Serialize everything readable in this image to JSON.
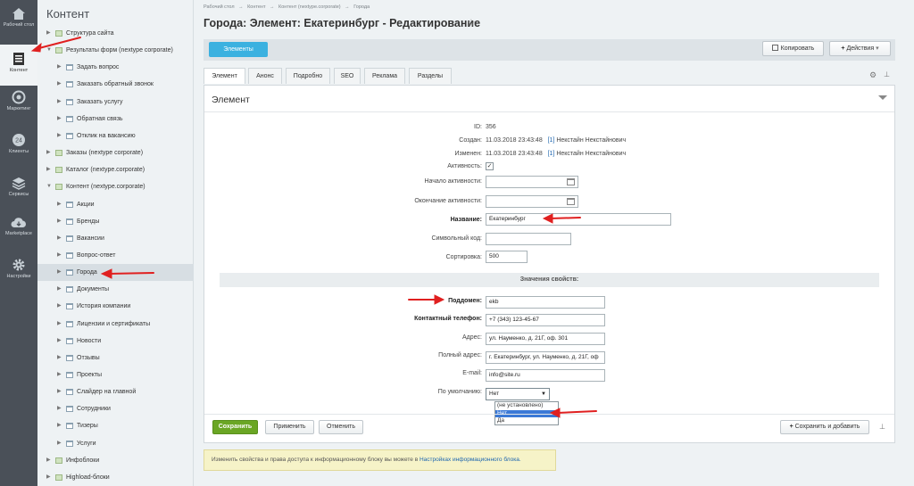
{
  "left_menu": [
    {
      "label": "Рабочий стол",
      "icon": "home-icon"
    },
    {
      "label": "Контент",
      "icon": "document-icon",
      "active": true
    },
    {
      "label": "Маркетинг",
      "icon": "target-icon"
    },
    {
      "label": "Клиенты",
      "icon": "clients-24-icon"
    },
    {
      "label": "Сервисы",
      "icon": "layers-icon"
    },
    {
      "label": "Marketplace",
      "icon": "cloud-download-icon"
    },
    {
      "label": "Настройки",
      "icon": "gear-icon"
    }
  ],
  "tree": {
    "title": "Контент",
    "items": [
      {
        "label": "Структура сайта",
        "level": 0,
        "type": "folder"
      },
      {
        "label": "Результаты форм (nextype corporate)",
        "level": 0,
        "type": "folder",
        "open": true
      },
      {
        "label": "Задать вопрос",
        "level": 1,
        "type": "page"
      },
      {
        "label": "Заказать обратный звонок",
        "level": 1,
        "type": "page"
      },
      {
        "label": "Заказать услугу",
        "level": 1,
        "type": "page"
      },
      {
        "label": "Обратная связь",
        "level": 1,
        "type": "page"
      },
      {
        "label": "Отклик на вакансию",
        "level": 1,
        "type": "page"
      },
      {
        "label": "Заказы (nextype corporate)",
        "level": 0,
        "type": "folder"
      },
      {
        "label": "Каталог (nextype.corporate)",
        "level": 0,
        "type": "folder"
      },
      {
        "label": "Контент (nextype.corporate)",
        "level": 0,
        "type": "folder",
        "open": true
      },
      {
        "label": "Акции",
        "level": 1,
        "type": "page"
      },
      {
        "label": "Бренды",
        "level": 1,
        "type": "page"
      },
      {
        "label": "Вакансии",
        "level": 1,
        "type": "page"
      },
      {
        "label": "Вопрос-ответ",
        "level": 1,
        "type": "page"
      },
      {
        "label": "Города",
        "level": 1,
        "type": "page",
        "selected": true
      },
      {
        "label": "Документы",
        "level": 1,
        "type": "page"
      },
      {
        "label": "История компании",
        "level": 1,
        "type": "page"
      },
      {
        "label": "Лицензии и сертификаты",
        "level": 1,
        "type": "page"
      },
      {
        "label": "Новости",
        "level": 1,
        "type": "page"
      },
      {
        "label": "Отзывы",
        "level": 1,
        "type": "page"
      },
      {
        "label": "Проекты",
        "level": 1,
        "type": "page"
      },
      {
        "label": "Слайдер на главной",
        "level": 1,
        "type": "page"
      },
      {
        "label": "Сотрудники",
        "level": 1,
        "type": "page"
      },
      {
        "label": "Тизеры",
        "level": 1,
        "type": "page"
      },
      {
        "label": "Услуги",
        "level": 1,
        "type": "page"
      },
      {
        "label": "Инфоблоки",
        "level": 0,
        "type": "folder"
      },
      {
        "label": "Highload-блоки",
        "level": 0,
        "type": "folder"
      }
    ]
  },
  "breadcrumbs": [
    "Рабочий стол",
    "→",
    "Контент",
    "→",
    "Контент (nextype.corporate)",
    "→",
    "Города"
  ],
  "page_title": "Города: Элемент: Екатеринбург - Редактирование",
  "toolbar": {
    "elements": "Элементы",
    "copy": "Копировать",
    "actions": "Действия"
  },
  "tabs": [
    "Элемент",
    "Анонс",
    "Подробно",
    "SEO",
    "Реклама",
    "Разделы"
  ],
  "panel_title": "Элемент",
  "form": {
    "id_label": "ID:",
    "id_value": "356",
    "created_label": "Создан:",
    "created_value": "11.03.2018 23:43:48",
    "created_user_link": "[1]",
    "created_user": "Некстайн Некстайнович",
    "changed_label": "Изменен:",
    "changed_value": "11.03.2018 23:43:48",
    "changed_user_link": "[1]",
    "changed_user": "Некстайн Некстайнович",
    "active_label": "Активность:",
    "start_label": "Начало активности:",
    "end_label": "Окончание активности:",
    "name_label": "Название:",
    "name_value": "Екатеринбург",
    "code_label": "Символьный код:",
    "code_value": "",
    "sort_label": "Сортировка:",
    "sort_value": "500",
    "props_header": "Значения свойств:",
    "subdomain_label": "Поддомен:",
    "subdomain_value": "ekb",
    "phone_label": "Контактный телефон:",
    "phone_value": "+7 (343) 123-45-67",
    "address_label": "Адрес:",
    "address_value": "ул. Науменко, д. 21Г, оф. 301",
    "full_address_label": "Полный адрес:",
    "full_address_value": "г. Екатеринбург, ул. Науменко, д. 21Г, оф",
    "email_label": "E-mail:",
    "email_value": "info@site.ru",
    "default_label": "По умолчанию:",
    "default_value": "Нет",
    "default_options": [
      "(не установлено)",
      "Нет",
      "Да"
    ]
  },
  "footer": {
    "save": "Сохранить",
    "apply": "Применить",
    "cancel": "Отменить",
    "save_add": "Сохранить и добавить"
  },
  "notice": {
    "text": "Изменить свойства и права доступа к информационному блоку вы можете в ",
    "link": "Настройках информационного блока."
  }
}
